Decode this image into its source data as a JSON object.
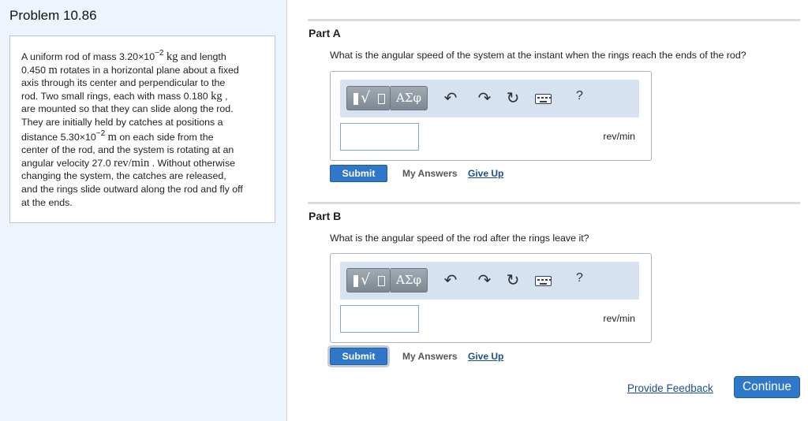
{
  "problem": {
    "title": "Problem 10.86",
    "text": {
      "t1": "A uniform rod of mass 3.20×10",
      "exp1": "−2",
      "u1": "kg",
      "t2": " and length",
      "t3": "0.450 ",
      "u2": "m",
      "t4": " rotates in a horizontal plane about a fixed",
      "line3": "axis through its center and perpendicular to the",
      "t5": "rod. Two small rings, each with mass 0.180 ",
      "u3": "kg",
      "t6": " ,",
      "line5": "are mounted so that they can slide along the rod.",
      "line6": "They are initially held by catches at positions a",
      "t7": "distance 5.30×10",
      "exp2": "−2",
      "u4": "m",
      "t8": " on each side from the",
      "line8": "center of the rod, and the system is rotating at an",
      "t9": "angular velocity 27.0 ",
      "u5": "rev/min",
      "t10": " . Without otherwise",
      "line10": "changing the system, the catches are released,",
      "line11": "and the rings slide outward along the rod and fly off",
      "line12": "at the ends."
    }
  },
  "toolbar": {
    "greek_label": "ΑΣφ",
    "undo_icon": "undo-icon",
    "redo_icon": "redo-icon",
    "reset_icon": "reset-icon",
    "keyboard_icon": "keyboard-icon",
    "help_label": "?"
  },
  "parts": [
    {
      "title": "Part A",
      "question": "What is the angular speed of the system at the instant when the rings reach the ends of the rod?",
      "input_value": "",
      "unit": "rev/min",
      "submit_label": "Submit",
      "my_answers_label": "My Answers",
      "give_up_label": "Give Up"
    },
    {
      "title": "Part B",
      "question": "What is the angular speed of the rod after the rings leave it?",
      "input_value": "",
      "unit": "rev/min",
      "submit_label": "Submit",
      "my_answers_label": "My Answers",
      "give_up_label": "Give Up"
    }
  ],
  "footer": {
    "feedback_label": "Provide Feedback",
    "continue_label": "Continue"
  },
  "colors": {
    "accent": "#2f78c9",
    "link": "#1b4f8a",
    "left_panel_bg": "#eef4fb",
    "toolbar_bg": "#d6e2ef"
  }
}
